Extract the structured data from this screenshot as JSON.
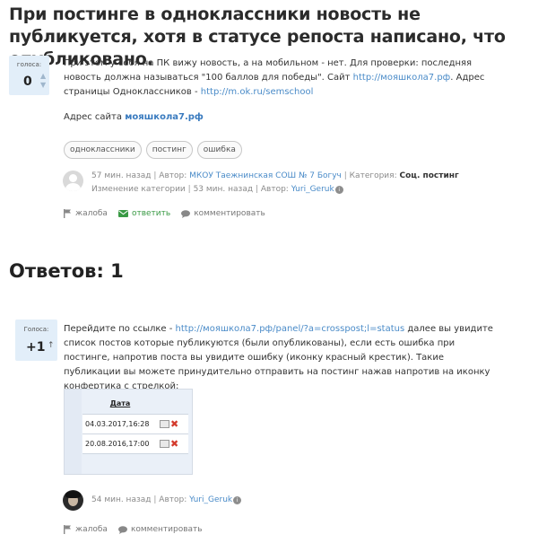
{
  "question": {
    "title": "При постинге в одноклассники новость не публикуется, хотя в статусе репоста написано, что опубликовано.",
    "vote_label": "голоса:",
    "vote_count": "0",
    "body_part1": "При этом у себя на ПК вижу новость, а на мобильном - нет. Для проверки: последняя новость должна называться \"100 баллов для победы\". Сайт ",
    "site_link": "http://мояшкола7.рф",
    "body_part2": ". Адрес страницы Одноклассников - ",
    "ok_link": "http://m.ok.ru/semschool",
    "site_label": "Адрес сайта",
    "site_short": "мояшкола7.рф",
    "tags": [
      "одноклассники",
      "постинг",
      "ошибка"
    ],
    "meta": {
      "time": "57 мин. назад",
      "author_prefix": "Автор:",
      "author": "МКОУ Таежнинская СОШ № 7 Богуч",
      "category_prefix": "Категория:",
      "category": "Соц. постинг",
      "changed": "Изменение категории",
      "changed_time": "53 мин. назад",
      "changed_author_prefix": "Автор:",
      "changed_author": "Yuri_Geruk",
      "badge": "i"
    },
    "actions": {
      "complaint": "жалоба",
      "reply": "ответить",
      "comment": "комментировать"
    }
  },
  "answers_heading": "Ответов: 1",
  "answer": {
    "vote_label": "Голоса:",
    "vote_count": "+1",
    "body_part1": "Перейдите по ссылке - ",
    "link": "http://мояшкола7.рф/panel/?a=crosspost;l=status",
    "body_part2": " далее вы увидите список постов которые публикуются (были опубликованы), если есть ошибка при постинге, напротив поста вы увидите ошибку (иконку красный крестик). Такие публикации вы можете принудительно отправить на постинг нажав напротив на иконку конфертика с стрелкой:",
    "screenshot": {
      "header": "Дата",
      "rows": [
        "04.03.2017,16:28",
        "20.08.2016,17:00"
      ]
    },
    "meta": {
      "time": "54 мин. назад",
      "author_prefix": "Автор:",
      "author": "Yuri_Geruk",
      "badge": "i"
    },
    "actions": {
      "complaint": "жалоба",
      "comment": "комментировать"
    }
  },
  "colors": {
    "link": "#4a8bc8",
    "vote_bg": "#e2eef9",
    "reply_green": "#3a9a45",
    "error_red": "#d33a2c"
  }
}
